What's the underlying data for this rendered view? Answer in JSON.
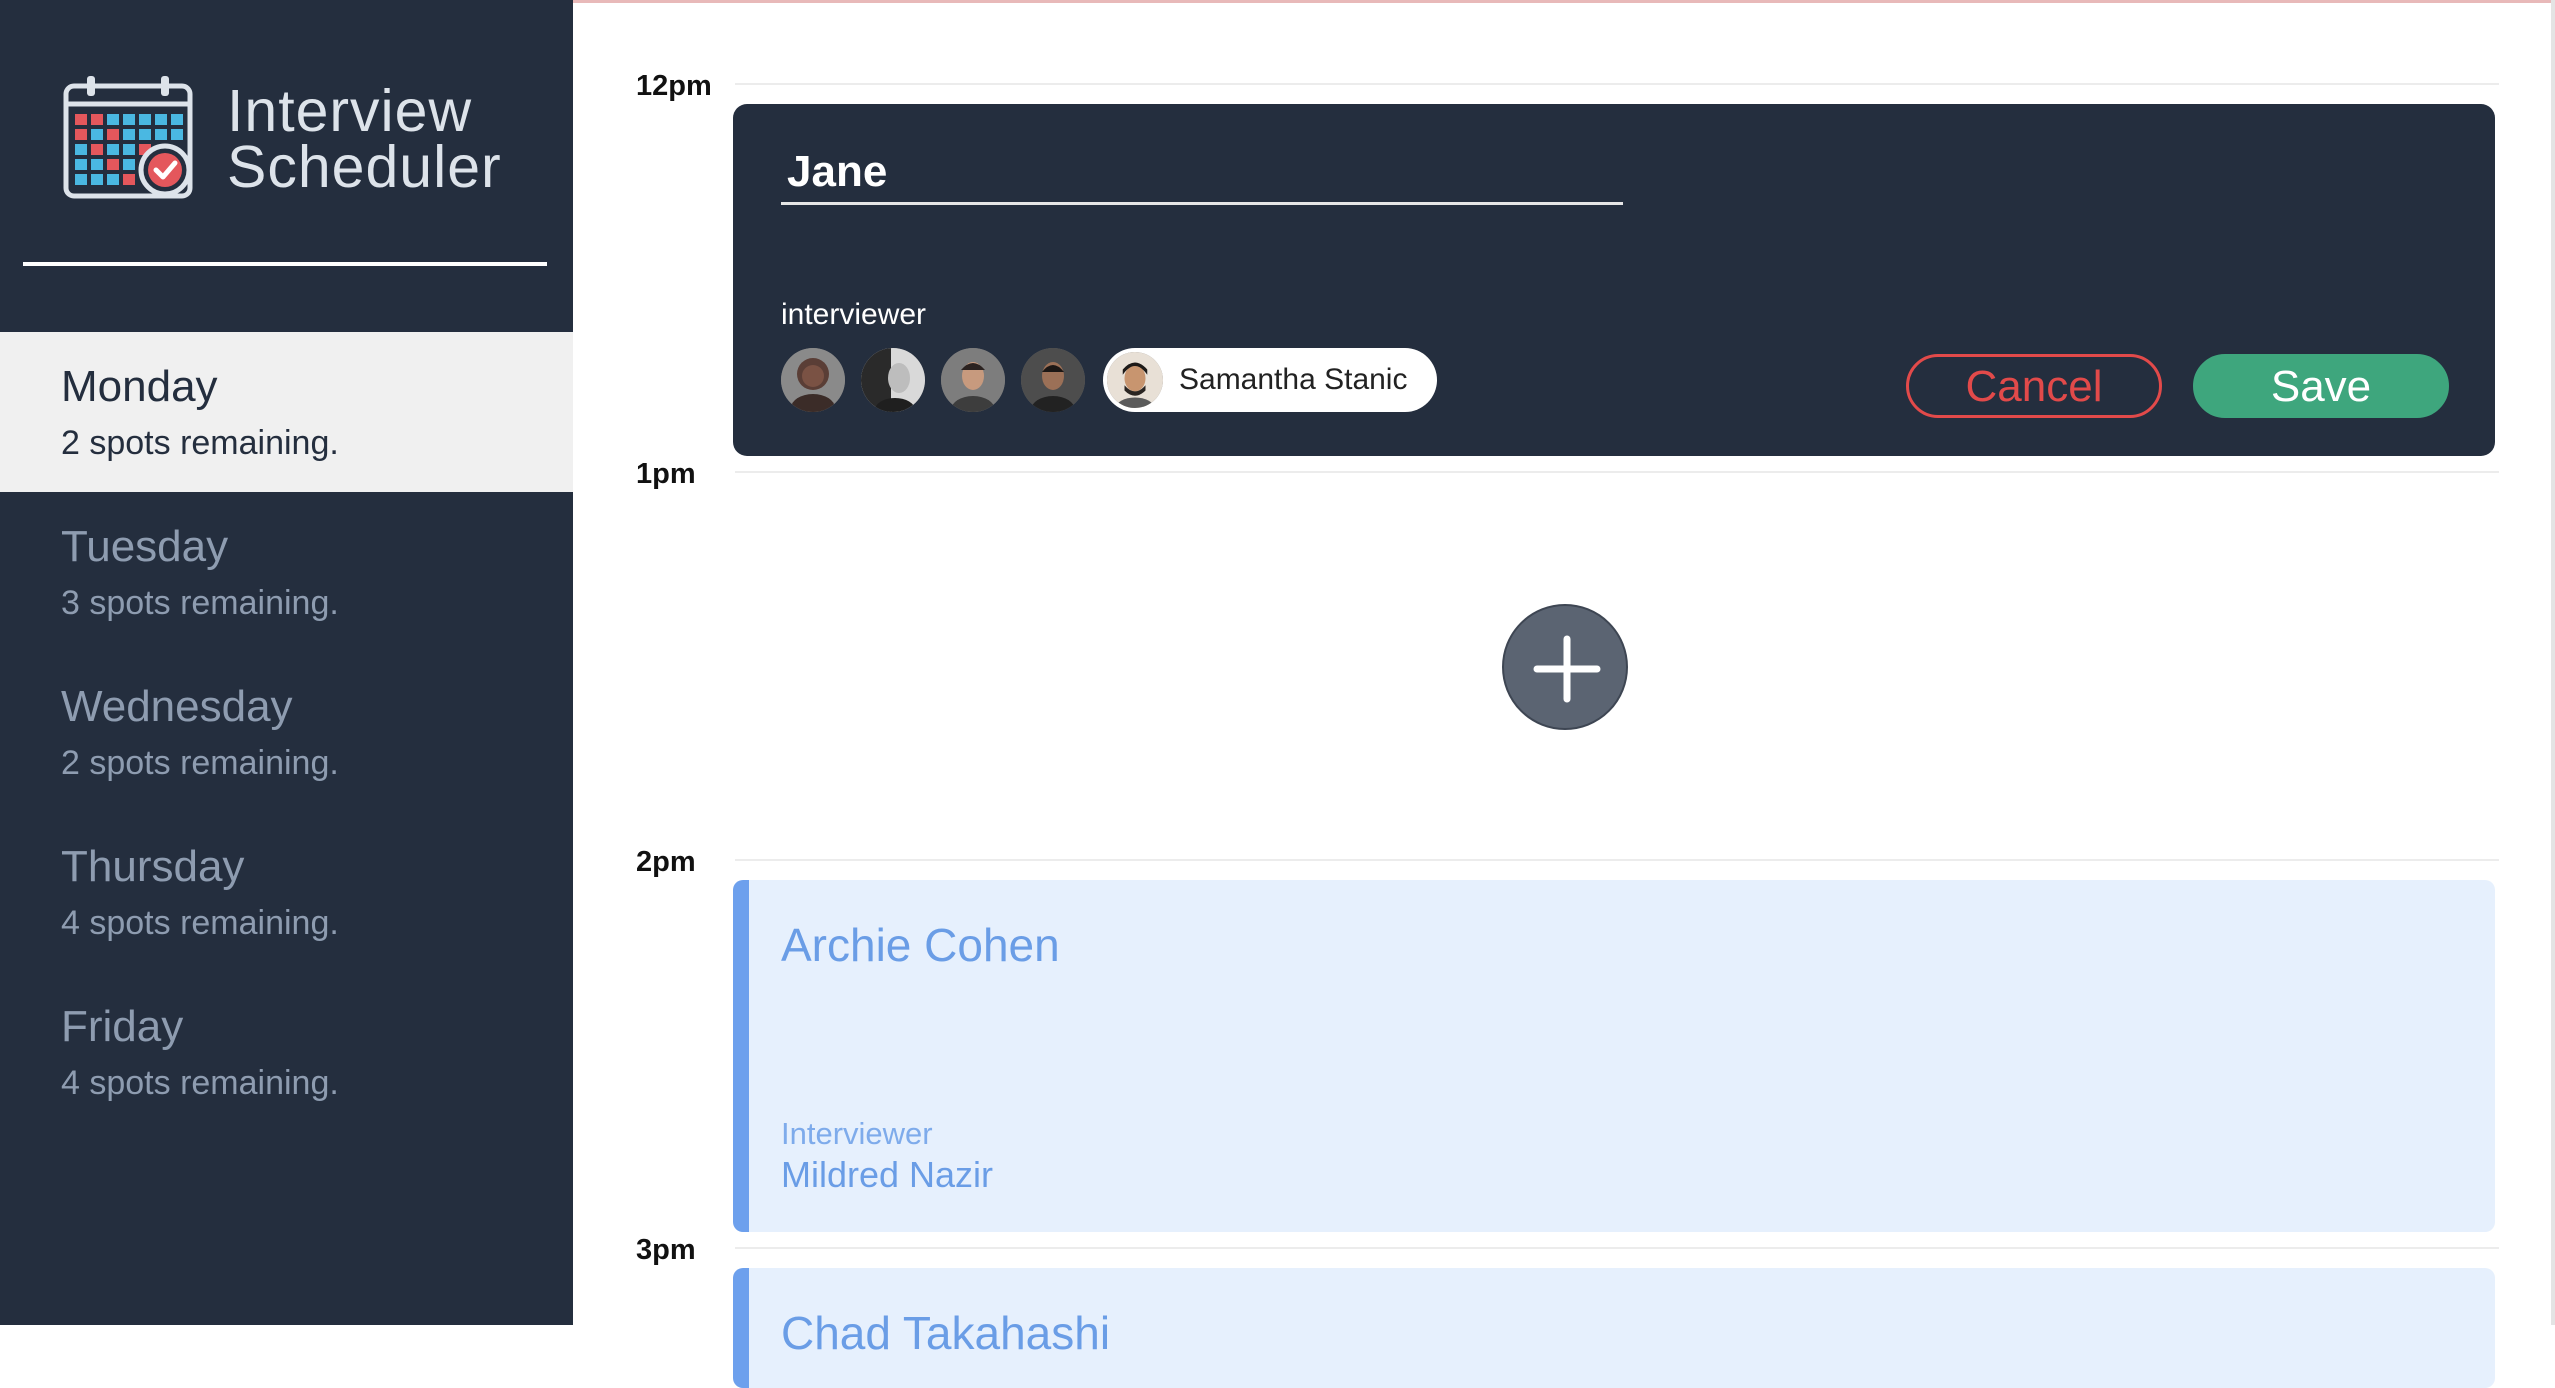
{
  "app": {
    "title_line1": "Interview",
    "title_line2": "Scheduler"
  },
  "sidebar": {
    "days": [
      {
        "name": "Monday",
        "spots": "2 spots remaining.",
        "active": true
      },
      {
        "name": "Tuesday",
        "spots": "3 spots remaining.",
        "active": false
      },
      {
        "name": "Wednesday",
        "spots": "2 spots remaining.",
        "active": false
      },
      {
        "name": "Thursday",
        "spots": "4 spots remaining.",
        "active": false
      },
      {
        "name": "Friday",
        "spots": "4 spots remaining.",
        "active": false
      }
    ]
  },
  "schedule": {
    "hours": [
      "12pm",
      "1pm",
      "2pm",
      "3pm"
    ],
    "form": {
      "student_name_value": "Jane",
      "interviewer_label": "interviewer",
      "selected_interviewer": "Samantha Stanic",
      "cancel_label": "Cancel",
      "save_label": "Save"
    },
    "appointments": [
      {
        "student": "Archie Cohen",
        "interviewer_label": "Interviewer",
        "interviewer": "Mildred Nazir"
      },
      {
        "student": "Chad Takahashi",
        "interviewer_label": "",
        "interviewer": ""
      }
    ]
  },
  "colors": {
    "sidebar_bg": "#242e3e",
    "cancel": "#e24a4a",
    "save": "#3ea67d",
    "appointment_accent": "#6da0ed",
    "appointment_bg": "#e6f0fd"
  },
  "icons": [
    "calendar-logo-icon",
    "plus-icon"
  ]
}
